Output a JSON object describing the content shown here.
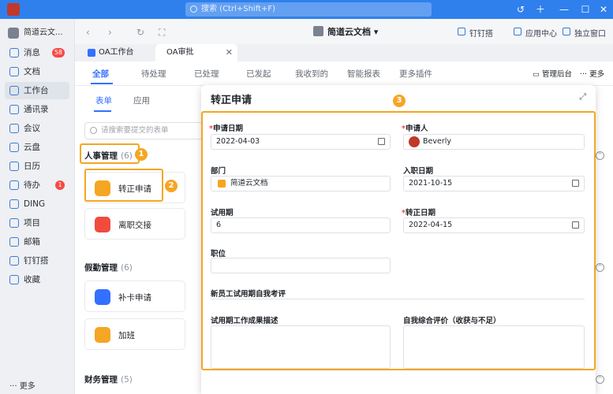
{
  "titlebar": {
    "search_placeholder": "搜索 (Ctrl+Shift+F)",
    "icons": [
      "history-icon",
      "plus-icon",
      "minimize-icon",
      "maximize-icon",
      "close-icon"
    ]
  },
  "sidebar": {
    "org_name": "简道云文...",
    "items": [
      {
        "label": "消息",
        "badge": "58"
      },
      {
        "label": "文档"
      },
      {
        "label": "工作台"
      },
      {
        "label": "通讯录"
      },
      {
        "label": "会议"
      },
      {
        "label": "云盘"
      },
      {
        "label": "日历"
      },
      {
        "label": "待办",
        "badge": "1"
      },
      {
        "label": "DING"
      },
      {
        "label": "项目"
      },
      {
        "label": "邮箱"
      },
      {
        "label": "钉钉搭"
      },
      {
        "label": "收藏"
      }
    ],
    "more": "更多"
  },
  "topbar": {
    "title": "简道云文档",
    "links": [
      "钉钉搭",
      "应用中心",
      "独立窗口"
    ]
  },
  "tabs": [
    {
      "label": "OA工作台"
    },
    {
      "label": "OA审批"
    }
  ],
  "main": {
    "tabs": [
      "全部",
      "待处理",
      "已处理",
      "已发起",
      "我收到的",
      "智能报表",
      "更多插件"
    ],
    "tools": [
      "管理后台",
      "更多"
    ],
    "subtabs": [
      "表单",
      "应用"
    ],
    "search_placeholder": "请搜索要提交的表单",
    "sections": [
      {
        "title": "人事管理",
        "count": "(6)",
        "cards": [
          "转正申请",
          "离职交接"
        ]
      },
      {
        "title": "假勤管理",
        "count": "(6)",
        "cards": [
          "补卡申请",
          "加班"
        ]
      },
      {
        "title": "财务管理",
        "count": "(5)"
      }
    ],
    "markers": [
      "1",
      "2",
      "3"
    ]
  },
  "panel": {
    "title": "转正申请",
    "fields": {
      "apply_date": {
        "label": "申请日期",
        "value": "2022-04-03"
      },
      "applicant": {
        "label": "申请人",
        "value": "Beverly"
      },
      "department": {
        "label": "部门",
        "value": "简道云文档"
      },
      "join_date": {
        "label": "入职日期",
        "value": "2021-10-15"
      },
      "probation": {
        "label": "试用期",
        "value": "6"
      },
      "regular_date": {
        "label": "转正日期",
        "value": "2022-04-15"
      },
      "position": {
        "label": "职位",
        "value": ""
      },
      "section": "新员工试用期自我考评",
      "work_desc": {
        "label": "试用期工作成果描述"
      },
      "self_eval": {
        "label": "自我综合评价（收获与不足）"
      }
    }
  },
  "colors": {
    "brand": "#3370ff",
    "highlight": "#f5a623",
    "titlebar": "#2f80ed"
  }
}
